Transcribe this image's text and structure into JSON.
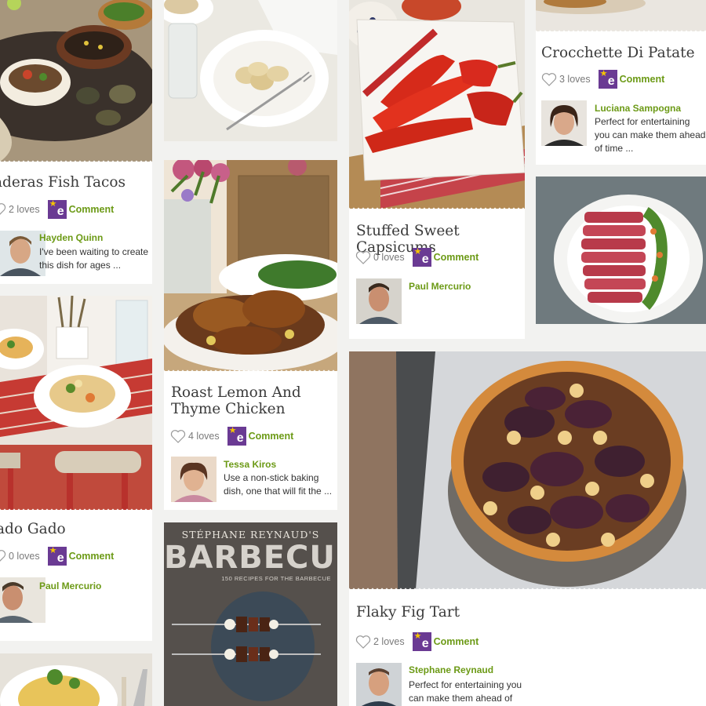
{
  "cards": [
    {
      "id": "fish-tacos",
      "title": "aderas Fish Tacos",
      "loves": "2 loves",
      "comment": "Comment",
      "author": "Hayden Quinn",
      "text": "I've been waiting to create this dish for ages ..."
    },
    {
      "id": "gado-gado",
      "title": "ado Gado",
      "loves": "0 loves",
      "comment": "Comment",
      "author": "Paul Mercurio",
      "text": ""
    },
    {
      "id": "roast-lemon",
      "title": "Roast Lemon And Thyme Chicken",
      "loves": "4 loves",
      "comment": "Comment",
      "author": "Tessa Kiros",
      "text": "Use a non-stick baking dish, one that will fit the ..."
    },
    {
      "id": "capsicums",
      "title": "Stuffed Sweet Capsicums",
      "loves": "0 loves",
      "comment": "Comment",
      "author": "Paul Mercurio",
      "text": ""
    },
    {
      "id": "fig-tart",
      "title": "Flaky Fig Tart",
      "loves": "2 loves",
      "comment": "Comment",
      "author": "Stephane Reynaud",
      "text": "Perfect for entertaining you can make them ahead of"
    },
    {
      "id": "crocchette",
      "title": "Crocchette Di Patate",
      "loves": "3 loves",
      "comment": "Comment",
      "author": "Luciana Sampogna",
      "text": "Perfect for entertaining you can make them ahead of time ..."
    }
  ],
  "book": {
    "author": "STÉPHANE REYNAUD'S",
    "title": "BARBECUE",
    "subtitle": "150 RECIPES FOR THE BARBECUE"
  },
  "colors": {
    "accent_green": "#6c9a16",
    "badge_purple": "#6a3a93",
    "badge_star": "#f5c400"
  }
}
